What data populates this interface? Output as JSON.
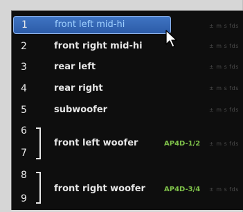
{
  "meta_text": "± m s fds",
  "rows": [
    {
      "num": "1",
      "label": "front left mid-hi",
      "selected": true
    },
    {
      "num": "2",
      "label": "front right mid-hi"
    },
    {
      "num": "3",
      "label": "rear left"
    },
    {
      "num": "4",
      "label": "rear right"
    },
    {
      "num": "5",
      "label": "subwoofer"
    }
  ],
  "groups": [
    {
      "nums": [
        "6",
        "7"
      ],
      "label": "front left woofer",
      "tag": "AP4D-1/2"
    },
    {
      "nums": [
        "8",
        "9"
      ],
      "label": "front right woofer",
      "tag": "AP4D-3/4"
    }
  ],
  "colors": {
    "selection": "#2f60ad",
    "tag": "#7fc24a",
    "text": "#e6e6e6"
  },
  "icons": {
    "cursor": "arrow-pointer-icon"
  }
}
